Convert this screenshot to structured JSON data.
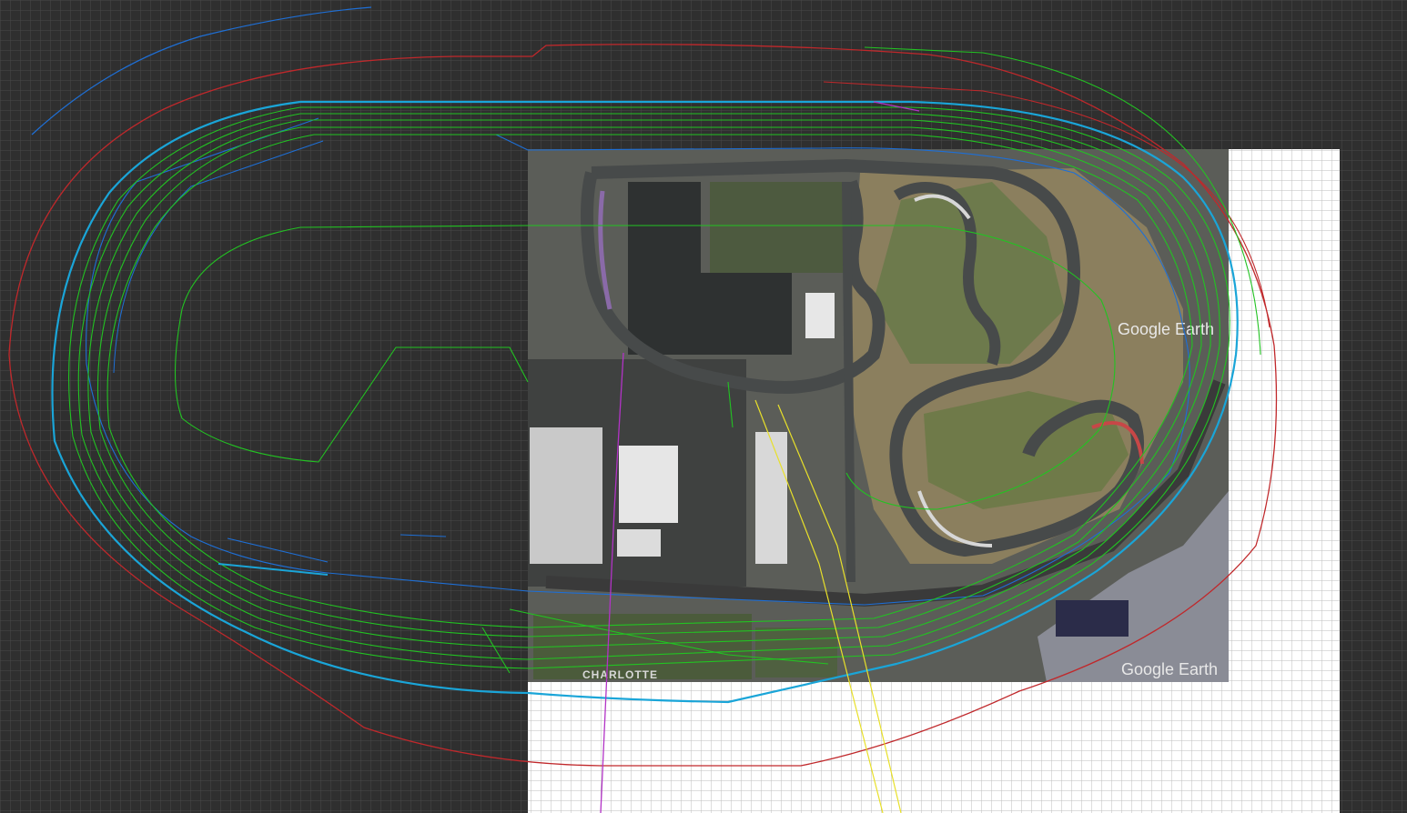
{
  "canvas": {
    "background_color": "#2f2f2f",
    "dark_grid_color": "#4a4a4a",
    "light_grid_color": "#bdbdbd",
    "light_area_color": "#ffffff"
  },
  "satellite_image": {
    "watermark_top": "Google Earth",
    "watermark_bottom": "Google Earth",
    "signage_text": "CHARLOTTE"
  },
  "paths": {
    "colors": {
      "boundary": "#c0282b",
      "centerline": "#1e6fd6",
      "lanes": "#22c322",
      "reference": "#b233c6",
      "cyan": "#1aa5d8",
      "yellow": "#e8e02a"
    }
  }
}
